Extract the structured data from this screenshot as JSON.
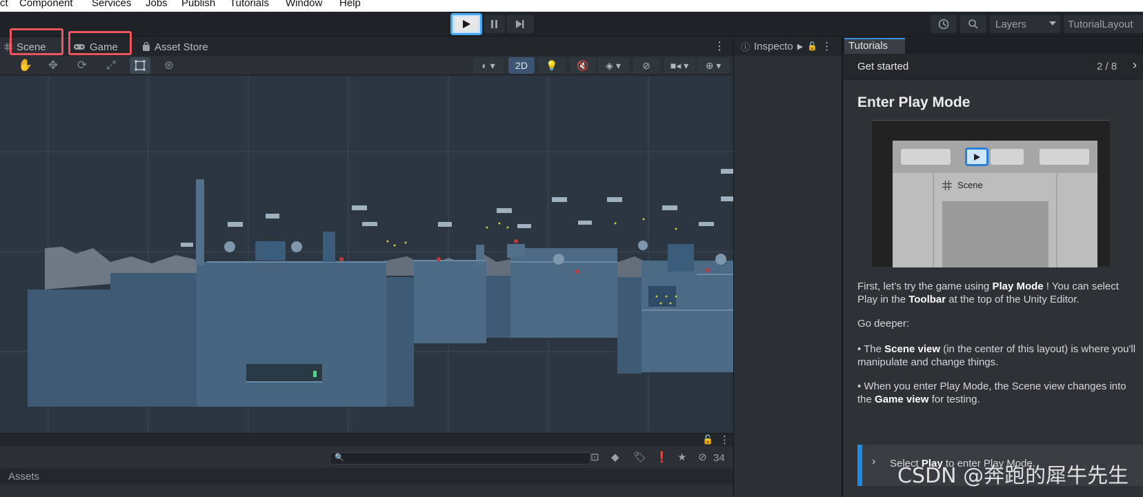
{
  "menubar": {
    "items": [
      "ct",
      "Component",
      "Services",
      "Jobs",
      "Publish",
      "Tutorials",
      "Window",
      "Help"
    ]
  },
  "toolbar": {
    "play_icon": "play-icon",
    "pause_icon": "pause-icon",
    "step_icon": "step-icon",
    "layers_label": "Layers",
    "layout_label": "TutorialLayout"
  },
  "scene_panel": {
    "tabs": [
      {
        "label": "Scene",
        "icon": "grid-icon",
        "highlighted": true
      },
      {
        "label": "Game",
        "icon": "gamepad-icon",
        "highlighted": true
      },
      {
        "label": "Asset Store",
        "icon": "shopping-bag-icon",
        "highlighted": false
      }
    ],
    "toolbar": {
      "view_2d_label": "2D"
    }
  },
  "project_panel": {
    "hidden_count": "34",
    "assets_label": "Assets"
  },
  "inspector": {
    "tab_label": "Inspecto"
  },
  "tutorials": {
    "tab_label": "Tutorials",
    "header": "Get started",
    "progress": "2 / 8",
    "title": "Enter Play Mode",
    "preview_scene_label": "Scene",
    "para1_pre": "First, let's try the game using ",
    "para1_bold1": "Play Mode",
    "para1_mid": " ! You can select Play in the ",
    "para1_bold2": "Toolbar",
    "para1_post": " at the top of the Unity Editor.",
    "go_deeper": "Go deeper:",
    "bullet1_pre": "• The ",
    "bullet1_bold": "Scene view",
    "bullet1_post": " (in the center of this layout) is where you'll manipulate and change things.",
    "bullet2_pre": "• When you enter Play Mode, the Scene view changes into the ",
    "bullet2_bold": "Game view",
    "bullet2_post": " for testing.",
    "callout_pre": "Select ",
    "callout_bold": "Play",
    "callout_post": " to enter Play Mode."
  },
  "watermark": "CSDN @奔跑的犀牛先生",
  "colors": {
    "accent_blue": "#49a8f2",
    "highlight_red": "#f2545b",
    "tutorial_accent": "#1f8ae6"
  }
}
